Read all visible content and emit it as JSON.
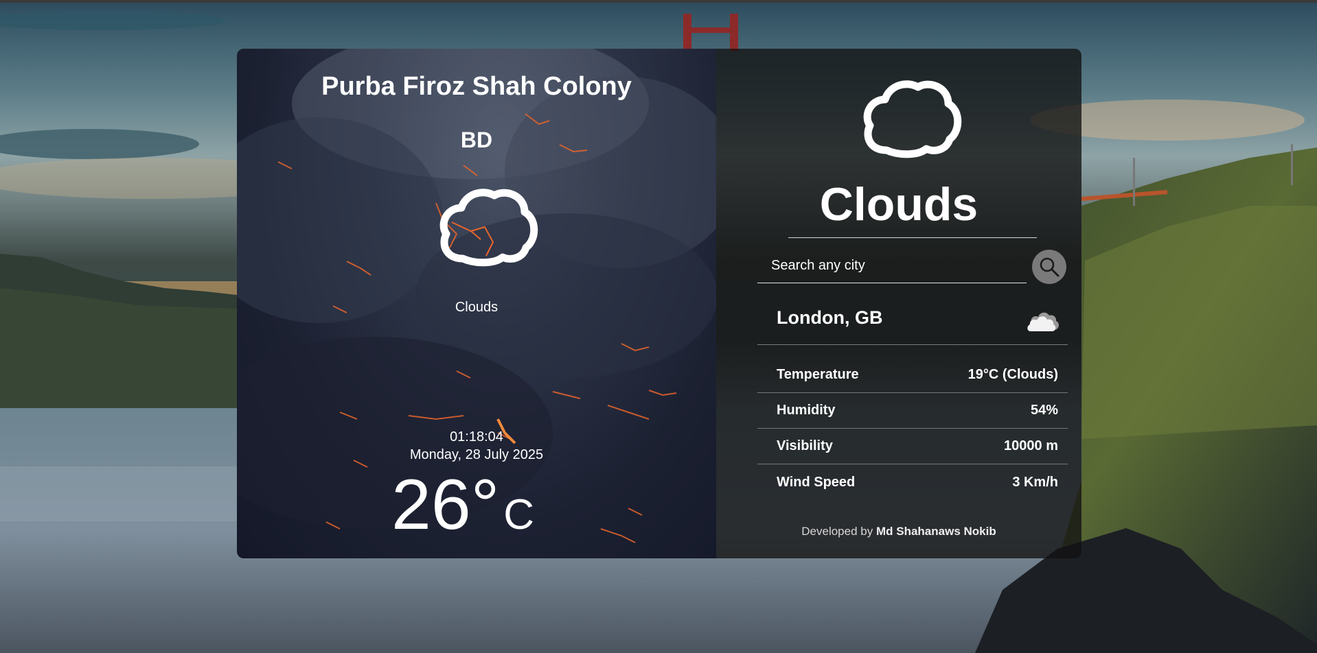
{
  "left": {
    "city": "Purba Firoz Shah Colony",
    "country": "BD",
    "condition": "Clouds",
    "time": "01:18:04",
    "date": "Monday, 28 July 2025",
    "temp_value": "26",
    "temp_degree": "°",
    "temp_unit": "C",
    "icon": "cloud-icon"
  },
  "right": {
    "icon": "cloud-icon",
    "condition": "Clouds",
    "search": {
      "placeholder": "Search any city",
      "value": "",
      "icon": "search-icon"
    },
    "location": "London, GB",
    "location_icon": "cloud-icon",
    "details": [
      {
        "label": "Temperature",
        "value": "19°C (Clouds)"
      },
      {
        "label": "Humidity",
        "value": "54%"
      },
      {
        "label": "Visibility",
        "value": "10000 m"
      },
      {
        "label": "Wind Speed",
        "value": "3 Km/h"
      }
    ],
    "credit_prefix": "Developed by",
    "credit_name": "Md Shahanaws Nokib"
  },
  "colors": {
    "left_panel_bg": "#1c2132",
    "right_panel_bg": "#121212",
    "accent_lava": "#e8652c",
    "search_button_bg": "#7a7a7a"
  }
}
